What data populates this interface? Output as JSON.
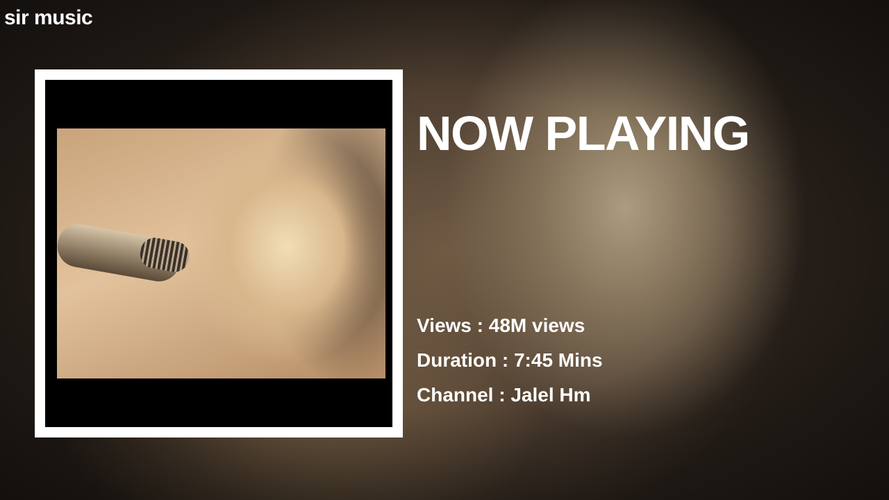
{
  "brand": "sir music",
  "heading": "NOW PLAYING",
  "details": {
    "views": "Views : 48M views",
    "duration": "Duration : 7:45 Mins",
    "channel": "Channel : Jalel Hm"
  },
  "colors": {
    "text": "#ffffff",
    "frame": "#ffffff",
    "art_background": "#000000"
  }
}
